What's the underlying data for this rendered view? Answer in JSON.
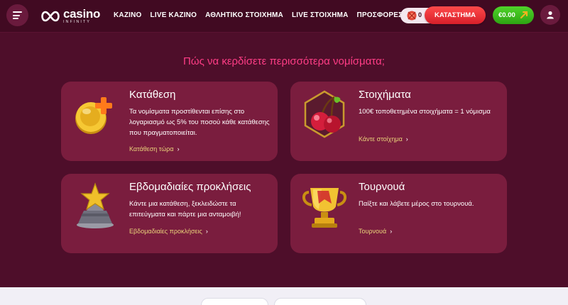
{
  "header": {
    "menu_icon": "hamburger-icon",
    "logo": {
      "word": "casino",
      "sub": "INFINITY"
    },
    "nav": [
      "ΚΑΖΙΝΟ",
      "LIVE ΚΑΖΙΝΟ",
      "ΑΘΛΗΤΙΚΟ ΣΤΟΙΧΗΜΑ",
      "LIVE ΣΤΟΙΧΗΜΑ",
      "ΠΡΟΣΦΟΡΕΣ"
    ],
    "coins": "0",
    "shop_label": "ΚΑΤΑΣΤΗΜΑ",
    "balance": "€0.00",
    "profile_icon": "user-icon"
  },
  "main": {
    "title": "Πώς να κερδίσετε περισσότερα νομίσματα;",
    "cards": [
      {
        "title": "Κατάθεση",
        "text": "Τα νομίσματα προστίθενται επίσης στο λογαριασμό ως 5% του ποσού κάθε κατάθεσης που πραγματοποιείται.",
        "link": "Κατάθεση τώρα",
        "icon": "coin-plus-icon"
      },
      {
        "title": "Στοιχήματα",
        "text": "100€ τοποθετημένα στοιχήματα = 1 νόμισμα",
        "link": "Κάντε στοίχημα",
        "icon": "cherries-icon"
      },
      {
        "title": "Εβδομαδιαίες προκλήσεις",
        "text": "Κάντε μια κατάθεση, ξεκλειδώστε τα επιτεύγματα και πάρτε μια ανταμοιβή!",
        "link": "Εβδομαδιαίες προκλήσεις",
        "icon": "star-trophy-icon"
      },
      {
        "title": "Τουρνουά",
        "text": "Παίξτε και λάβετε μέρος στο τουρνουά.",
        "link": "Τουρνουά",
        "icon": "gold-cup-icon"
      }
    ]
  },
  "colors": {
    "background": "#4e0e2a",
    "header": "#410a22",
    "card": "#7a1d3e",
    "title": "#ff3d86",
    "link": "#e9d27a",
    "shop": "#e8262f",
    "balance": "#3dbf1c"
  }
}
